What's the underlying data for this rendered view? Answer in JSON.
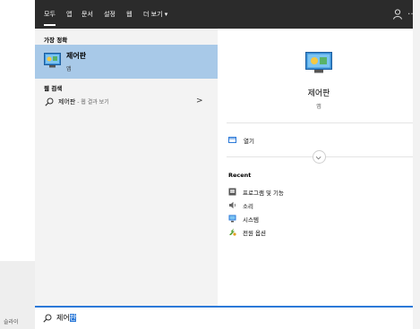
{
  "background": {
    "caption": "슬라이"
  },
  "tabs": [
    {
      "label": "모두"
    },
    {
      "label": "앱"
    },
    {
      "label": "문서"
    },
    {
      "label": "설정"
    },
    {
      "label": "웹"
    },
    {
      "label": "더 보기 ▾"
    }
  ],
  "topbar": {
    "more": "…"
  },
  "best_match": {
    "heading": "가장 정확",
    "name": "제어판",
    "type": "앱"
  },
  "web_search": {
    "heading": "웹 검색",
    "query": "제어판",
    "suffix": " - 웹 결과 보기",
    "chevron": ">"
  },
  "detail": {
    "title": "제어판",
    "subtitle": "앱",
    "open_label": "열기",
    "recent_heading": "Recent",
    "recent_items": [
      {
        "label": "프로그램 및 기능",
        "icon": "programs-icon"
      },
      {
        "label": "소리",
        "icon": "sound-icon"
      },
      {
        "label": "시스템",
        "icon": "system-icon"
      },
      {
        "label": "전원 옵션",
        "icon": "power-options-icon"
      }
    ]
  },
  "search": {
    "typed": "제어",
    "selected": "판"
  },
  "colors": {
    "accent": "#2b79d8",
    "selection": "#a8c9e8",
    "topbar": "#2b2b2b"
  }
}
